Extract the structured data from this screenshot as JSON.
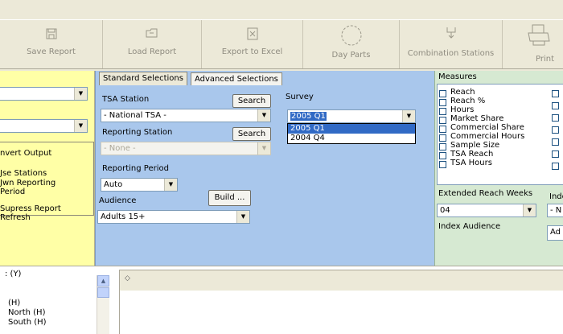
{
  "toolbar": {
    "buttons": [
      {
        "label": "Save Report",
        "icon": "floppy-icon"
      },
      {
        "label": "Load Report",
        "icon": "folder-icon"
      },
      {
        "label": "Export to Excel",
        "icon": "excel-icon"
      },
      {
        "label": "Day Parts",
        "icon": "clock-icon"
      },
      {
        "label": "Combination Stations",
        "icon": "merge-icon"
      },
      {
        "label": "Print",
        "icon": "printer-icon"
      }
    ]
  },
  "left_panel": {
    "options": [
      "nvert Output",
      "Jse Stations",
      "Jwn Reporting",
      "Period",
      "Supress Report",
      "Refresh"
    ]
  },
  "tabs": {
    "standard": "Standard Selections",
    "advanced": "Advanced Selections"
  },
  "standard": {
    "tsa_station_label": "TSA Station",
    "tsa_station_value": "- National TSA -",
    "search_label": "Search",
    "reporting_station_label": "Reporting Station",
    "reporting_station_value": "- None -",
    "reporting_period_label": "Reporting Period",
    "reporting_period_value": "Auto",
    "audience_label": "Audience",
    "audience_value": "Adults 15+",
    "build_label": "Build ...",
    "survey_label": "Survey",
    "survey_value": "2005 Q1",
    "survey_options": [
      "2005 Q1",
      "2004 Q4"
    ]
  },
  "measures": {
    "title": "Measures",
    "items": [
      "Reach",
      "Reach %",
      "Hours",
      "Market Share",
      "Commercial Share",
      "Commercial Hours",
      "Sample Size",
      "TSA Reach",
      "TSA Hours"
    ],
    "extended_label": "Extended Reach Weeks",
    "extended_value": "04",
    "index_audience_label": "Index Audience",
    "index_cut": "Inde",
    "index_combo_cut": "- N",
    "index_value_cut": "Ad"
  },
  "bottom": {
    "lines": [
      ": (Y)",
      "(H)",
      "North (H)",
      "South (H)"
    ]
  }
}
